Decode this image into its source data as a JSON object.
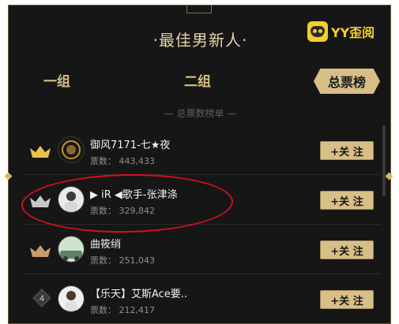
{
  "header": {
    "title": "·最佳男新人·",
    "logo_text": "YY歪阅"
  },
  "tabs": [
    {
      "label": "一组"
    },
    {
      "label": "二组"
    },
    {
      "label": "总票榜",
      "active": true
    }
  ],
  "subheader": "— 总票数榜单 —",
  "ranking": [
    {
      "rank_icon": "gold-crown-icon",
      "name": "御风7171-七★夜",
      "votes_label": "票数：",
      "votes": "443,433",
      "follow_label": "+关 注"
    },
    {
      "rank_icon": "silver-crown-icon",
      "name": "▶ iR ◀歌手-张津涤",
      "votes_label": "票数：",
      "votes": "329,842",
      "follow_label": "+关 注"
    },
    {
      "rank_icon": "bronze-crown-icon",
      "name": "曲筱绡",
      "votes_label": "票数：",
      "votes": "251,043",
      "follow_label": "+关 注"
    },
    {
      "rank_number": "4",
      "name": "【乐天】艾斯Ace要..",
      "votes_label": "票数：",
      "votes": "212,417",
      "follow_label": "+关 注"
    }
  ],
  "colors": {
    "gold": "#d8bf88",
    "panel_bg": "#161616",
    "highlight_red": "#d0111c"
  }
}
